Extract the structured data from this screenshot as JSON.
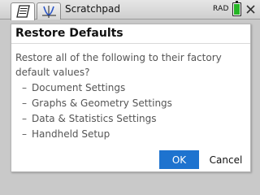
{
  "topbar": {
    "tabs": [
      {
        "icon": "calculator-icon",
        "active": true
      },
      {
        "icon": "graph-icon",
        "active": false
      }
    ],
    "document_title": "Scratchpad",
    "angle_mode": "RAD",
    "battery_level": 1.0,
    "battery_color": "#25b525",
    "close_icon": "close-icon"
  },
  "dialog": {
    "title": "Restore Defaults",
    "message": "Restore all of the following to their factory default values?",
    "items": [
      "Document Settings",
      "Graphs & Geometry Settings",
      "Data & Statistics Settings",
      "Handheld Setup"
    ],
    "ok_label": "OK",
    "cancel_label": "Cancel",
    "accent_color": "#1e73cf"
  }
}
